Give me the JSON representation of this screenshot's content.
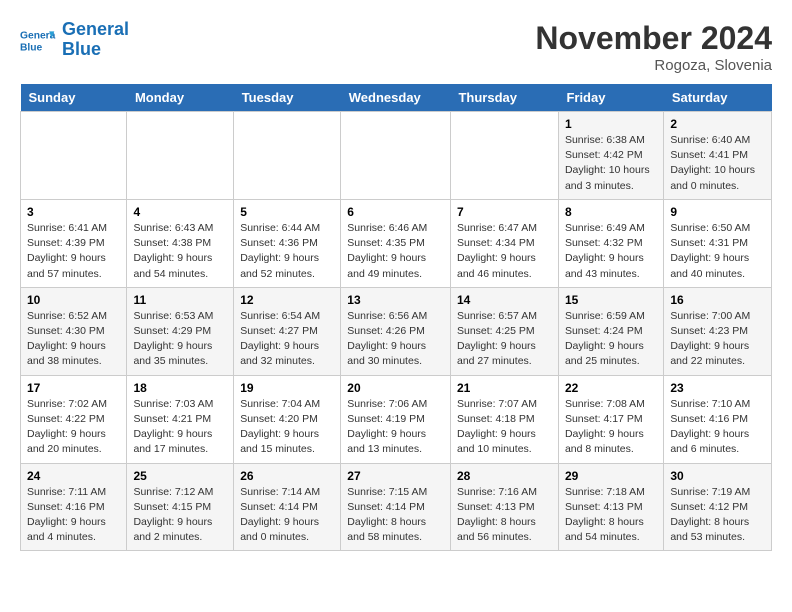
{
  "header": {
    "logo_line1": "General",
    "logo_line2": "Blue",
    "month": "November 2024",
    "location": "Rogoza, Slovenia"
  },
  "weekdays": [
    "Sunday",
    "Monday",
    "Tuesday",
    "Wednesday",
    "Thursday",
    "Friday",
    "Saturday"
  ],
  "weeks": [
    [
      {
        "day": "",
        "info": ""
      },
      {
        "day": "",
        "info": ""
      },
      {
        "day": "",
        "info": ""
      },
      {
        "day": "",
        "info": ""
      },
      {
        "day": "",
        "info": ""
      },
      {
        "day": "1",
        "info": "Sunrise: 6:38 AM\nSunset: 4:42 PM\nDaylight: 10 hours\nand 3 minutes."
      },
      {
        "day": "2",
        "info": "Sunrise: 6:40 AM\nSunset: 4:41 PM\nDaylight: 10 hours\nand 0 minutes."
      }
    ],
    [
      {
        "day": "3",
        "info": "Sunrise: 6:41 AM\nSunset: 4:39 PM\nDaylight: 9 hours\nand 57 minutes."
      },
      {
        "day": "4",
        "info": "Sunrise: 6:43 AM\nSunset: 4:38 PM\nDaylight: 9 hours\nand 54 minutes."
      },
      {
        "day": "5",
        "info": "Sunrise: 6:44 AM\nSunset: 4:36 PM\nDaylight: 9 hours\nand 52 minutes."
      },
      {
        "day": "6",
        "info": "Sunrise: 6:46 AM\nSunset: 4:35 PM\nDaylight: 9 hours\nand 49 minutes."
      },
      {
        "day": "7",
        "info": "Sunrise: 6:47 AM\nSunset: 4:34 PM\nDaylight: 9 hours\nand 46 minutes."
      },
      {
        "day": "8",
        "info": "Sunrise: 6:49 AM\nSunset: 4:32 PM\nDaylight: 9 hours\nand 43 minutes."
      },
      {
        "day": "9",
        "info": "Sunrise: 6:50 AM\nSunset: 4:31 PM\nDaylight: 9 hours\nand 40 minutes."
      }
    ],
    [
      {
        "day": "10",
        "info": "Sunrise: 6:52 AM\nSunset: 4:30 PM\nDaylight: 9 hours\nand 38 minutes."
      },
      {
        "day": "11",
        "info": "Sunrise: 6:53 AM\nSunset: 4:29 PM\nDaylight: 9 hours\nand 35 minutes."
      },
      {
        "day": "12",
        "info": "Sunrise: 6:54 AM\nSunset: 4:27 PM\nDaylight: 9 hours\nand 32 minutes."
      },
      {
        "day": "13",
        "info": "Sunrise: 6:56 AM\nSunset: 4:26 PM\nDaylight: 9 hours\nand 30 minutes."
      },
      {
        "day": "14",
        "info": "Sunrise: 6:57 AM\nSunset: 4:25 PM\nDaylight: 9 hours\nand 27 minutes."
      },
      {
        "day": "15",
        "info": "Sunrise: 6:59 AM\nSunset: 4:24 PM\nDaylight: 9 hours\nand 25 minutes."
      },
      {
        "day": "16",
        "info": "Sunrise: 7:00 AM\nSunset: 4:23 PM\nDaylight: 9 hours\nand 22 minutes."
      }
    ],
    [
      {
        "day": "17",
        "info": "Sunrise: 7:02 AM\nSunset: 4:22 PM\nDaylight: 9 hours\nand 20 minutes."
      },
      {
        "day": "18",
        "info": "Sunrise: 7:03 AM\nSunset: 4:21 PM\nDaylight: 9 hours\nand 17 minutes."
      },
      {
        "day": "19",
        "info": "Sunrise: 7:04 AM\nSunset: 4:20 PM\nDaylight: 9 hours\nand 15 minutes."
      },
      {
        "day": "20",
        "info": "Sunrise: 7:06 AM\nSunset: 4:19 PM\nDaylight: 9 hours\nand 13 minutes."
      },
      {
        "day": "21",
        "info": "Sunrise: 7:07 AM\nSunset: 4:18 PM\nDaylight: 9 hours\nand 10 minutes."
      },
      {
        "day": "22",
        "info": "Sunrise: 7:08 AM\nSunset: 4:17 PM\nDaylight: 9 hours\nand 8 minutes."
      },
      {
        "day": "23",
        "info": "Sunrise: 7:10 AM\nSunset: 4:16 PM\nDaylight: 9 hours\nand 6 minutes."
      }
    ],
    [
      {
        "day": "24",
        "info": "Sunrise: 7:11 AM\nSunset: 4:16 PM\nDaylight: 9 hours\nand 4 minutes."
      },
      {
        "day": "25",
        "info": "Sunrise: 7:12 AM\nSunset: 4:15 PM\nDaylight: 9 hours\nand 2 minutes."
      },
      {
        "day": "26",
        "info": "Sunrise: 7:14 AM\nSunset: 4:14 PM\nDaylight: 9 hours\nand 0 minutes."
      },
      {
        "day": "27",
        "info": "Sunrise: 7:15 AM\nSunset: 4:14 PM\nDaylight: 8 hours\nand 58 minutes."
      },
      {
        "day": "28",
        "info": "Sunrise: 7:16 AM\nSunset: 4:13 PM\nDaylight: 8 hours\nand 56 minutes."
      },
      {
        "day": "29",
        "info": "Sunrise: 7:18 AM\nSunset: 4:13 PM\nDaylight: 8 hours\nand 54 minutes."
      },
      {
        "day": "30",
        "info": "Sunrise: 7:19 AM\nSunset: 4:12 PM\nDaylight: 8 hours\nand 53 minutes."
      }
    ]
  ]
}
